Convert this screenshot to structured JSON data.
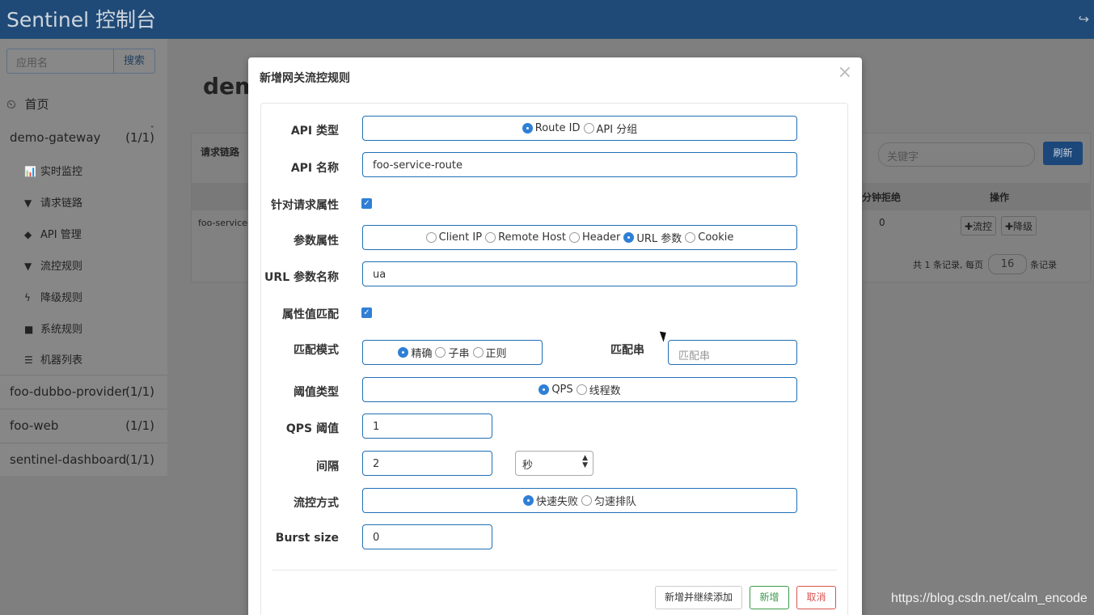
{
  "header": {
    "brand": "Sentinel 控制台",
    "logout_icon": "↪"
  },
  "sidebar": {
    "search_placeholder": "应用名",
    "search_button": "搜索",
    "home": "首页",
    "apps": [
      {
        "name": "demo-gateway",
        "count": "(1/1)"
      },
      {
        "name": "foo-dubbo-provider",
        "count": "(1/1)"
      },
      {
        "name": "foo-web",
        "count": "(1/1)"
      },
      {
        "name": "sentinel-dashboard",
        "count": "(1/1)"
      }
    ],
    "menu": [
      {
        "label": "实时监控",
        "icon": "bar-chart-icon"
      },
      {
        "label": "请求链路",
        "icon": "filter-icon"
      },
      {
        "label": "API 管理",
        "icon": "tags-icon"
      },
      {
        "label": "流控规则",
        "icon": "filter-icon"
      },
      {
        "label": "降级规则",
        "icon": "flash-icon"
      },
      {
        "label": "系统规则",
        "icon": "lock-icon"
      },
      {
        "label": "机器列表",
        "icon": "list-icon"
      }
    ]
  },
  "background": {
    "page_title": "dem",
    "panel_title": "请求链路",
    "keyword_placeholder": "关键字",
    "refresh": "刷新",
    "col_reject": "分钟拒绝",
    "col_ops": "操作",
    "row_resource": "foo-service-",
    "row_value": "0",
    "btn_flow": "✚流控",
    "btn_degrade": "✚降级",
    "pager_prefix": "共 1 条记录, 每页",
    "pager_size": "16",
    "pager_suffix": "条记录"
  },
  "modal": {
    "title": "新增网关流控规则",
    "close": "×",
    "api_type": {
      "label": "API 类型",
      "options": [
        "Route ID",
        "API 分组"
      ],
      "selected": "Route ID"
    },
    "api_name": {
      "label": "API 名称",
      "value": "foo-service-route"
    },
    "param_flag": {
      "label": "针对请求属性",
      "checked": true
    },
    "param_attr": {
      "label": "参数属性",
      "options": [
        "Client IP",
        "Remote Host",
        "Header",
        "URL 参数",
        "Cookie"
      ],
      "selected": "URL 参数"
    },
    "url_param_name": {
      "label": "URL 参数名称",
      "value": "ua"
    },
    "attr_match": {
      "label": "属性值匹配",
      "checked": true
    },
    "match_mode": {
      "label": "匹配模式",
      "options": [
        "精确",
        "子串",
        "正则"
      ],
      "selected": "精确"
    },
    "match_str": {
      "label": "匹配串",
      "placeholder": "匹配串"
    },
    "threshold_type": {
      "label": "阈值类型",
      "options": [
        "QPS",
        "线程数"
      ],
      "selected": "QPS"
    },
    "qps": {
      "label": "QPS 阈值",
      "value": "1"
    },
    "interval": {
      "label": "间隔",
      "value": "2",
      "unit": "秒"
    },
    "control_mode": {
      "label": "流控方式",
      "options": [
        "快速失败",
        "匀速排队"
      ],
      "selected": "快速失败"
    },
    "burst": {
      "label": "Burst size",
      "value": "0"
    },
    "buttons": {
      "add_continue": "新增并继续添加",
      "add": "新增",
      "cancel": "取消"
    }
  },
  "watermark": "https://blog.csdn.net/calm_encode",
  "colors": {
    "header": "#1f4a77",
    "primary": "#2f7fd6",
    "success": "#3c9a4a",
    "danger": "#d9534f"
  }
}
